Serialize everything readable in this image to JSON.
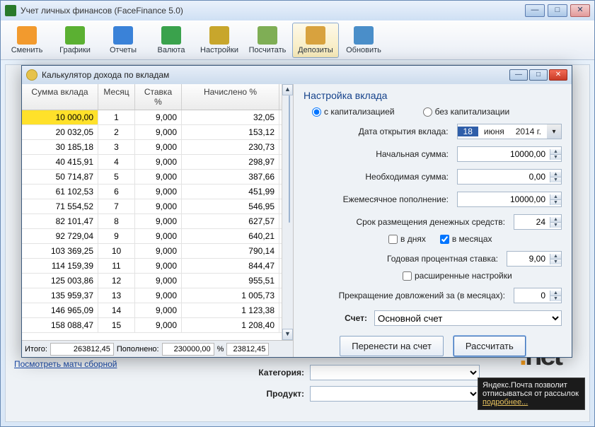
{
  "mainWindow": {
    "title": "Учет личных финансов (FaceFinance 5.0)"
  },
  "toolbar": [
    {
      "id": "swap",
      "label": "Сменить",
      "color": "#f29a2e"
    },
    {
      "id": "charts",
      "label": "Графики",
      "color": "#5bb032"
    },
    {
      "id": "reports",
      "label": "Отчеты",
      "color": "#3a82d8"
    },
    {
      "id": "currency",
      "label": "Валюта",
      "color": "#3aa24c"
    },
    {
      "id": "settings",
      "label": "Настройки",
      "color": "#c8a62c"
    },
    {
      "id": "calc",
      "label": "Посчитать",
      "color": "#7fae55"
    },
    {
      "id": "deposits",
      "label": "Депозиты",
      "color": "#d8a23e"
    },
    {
      "id": "refresh",
      "label": "Обновить",
      "color": "#4a8ec9"
    }
  ],
  "activeToolbar": "deposits",
  "dialog": {
    "title": "Калькулятор дохода по вкладам",
    "columns": {
      "sum": "Сумма вклада",
      "month": "Месяц",
      "rate": "Ставка %",
      "accrued": "Начислено %"
    },
    "rows": [
      {
        "sum": "10 000,00",
        "month": "1",
        "rate": "9,000",
        "accrued": "32,05",
        "selected": true
      },
      {
        "sum": "20 032,05",
        "month": "2",
        "rate": "9,000",
        "accrued": "153,12"
      },
      {
        "sum": "30 185,18",
        "month": "3",
        "rate": "9,000",
        "accrued": "230,73"
      },
      {
        "sum": "40 415,91",
        "month": "4",
        "rate": "9,000",
        "accrued": "298,97"
      },
      {
        "sum": "50 714,87",
        "month": "5",
        "rate": "9,000",
        "accrued": "387,66"
      },
      {
        "sum": "61 102,53",
        "month": "6",
        "rate": "9,000",
        "accrued": "451,99"
      },
      {
        "sum": "71 554,52",
        "month": "7",
        "rate": "9,000",
        "accrued": "546,95"
      },
      {
        "sum": "82 101,47",
        "month": "8",
        "rate": "9,000",
        "accrued": "627,57"
      },
      {
        "sum": "92 729,04",
        "month": "9",
        "rate": "9,000",
        "accrued": "640,21"
      },
      {
        "sum": "103 369,25",
        "month": "10",
        "rate": "9,000",
        "accrued": "790,14"
      },
      {
        "sum": "114 159,39",
        "month": "11",
        "rate": "9,000",
        "accrued": "844,47"
      },
      {
        "sum": "125 003,86",
        "month": "12",
        "rate": "9,000",
        "accrued": "955,51"
      },
      {
        "sum": "135 959,37",
        "month": "13",
        "rate": "9,000",
        "accrued": "1 005,73"
      },
      {
        "sum": "146 965,09",
        "month": "14",
        "rate": "9,000",
        "accrued": "1 123,38"
      },
      {
        "sum": "158 088,47",
        "month": "15",
        "rate": "9,000",
        "accrued": "1 208,40"
      }
    ],
    "totals": {
      "label_total": "Итого:",
      "total": "263812,45",
      "label_topup": "Пополнено:",
      "topup": "230000,00",
      "label_pct": "%",
      "pct": "23812,45"
    }
  },
  "settings": {
    "header": "Настройка вклада",
    "radio_cap": "с капитализацией",
    "radio_nocap": "без капитализации",
    "date_label": "Дата открытия вклада:",
    "date_day": "18",
    "date_month": "июня",
    "date_year": "2014 г.",
    "initial_label": "Начальная сумма:",
    "initial": "10000,00",
    "required_label": "Необходимая сумма:",
    "required": "0,00",
    "monthly_label": "Ежемесячное пополнение:",
    "monthly": "10000,00",
    "term_label": "Срок размещения денежных средств:",
    "term": "24",
    "check_days": "в днях",
    "check_months": "в месяцах",
    "rate_label": "Годовая процентная ставка:",
    "rate": "9,00",
    "advanced": "расширенные настройки",
    "stop_label": "Прекращение довложений за (в месяцах):",
    "stop": "0",
    "account_label": "Счет:",
    "account": "Основной счет",
    "btn_transfer": "Перенести на счет",
    "btn_calc": "Рассчитать"
  },
  "background": {
    "link": "Посмотреть матч сборной",
    "category_label": "Категория:",
    "product_label": "Продукт:",
    "net_logo": "net",
    "yamail": "Яндекс.Почта позволит отписываться от рассылок",
    "yamail_more": "подробнее..."
  }
}
